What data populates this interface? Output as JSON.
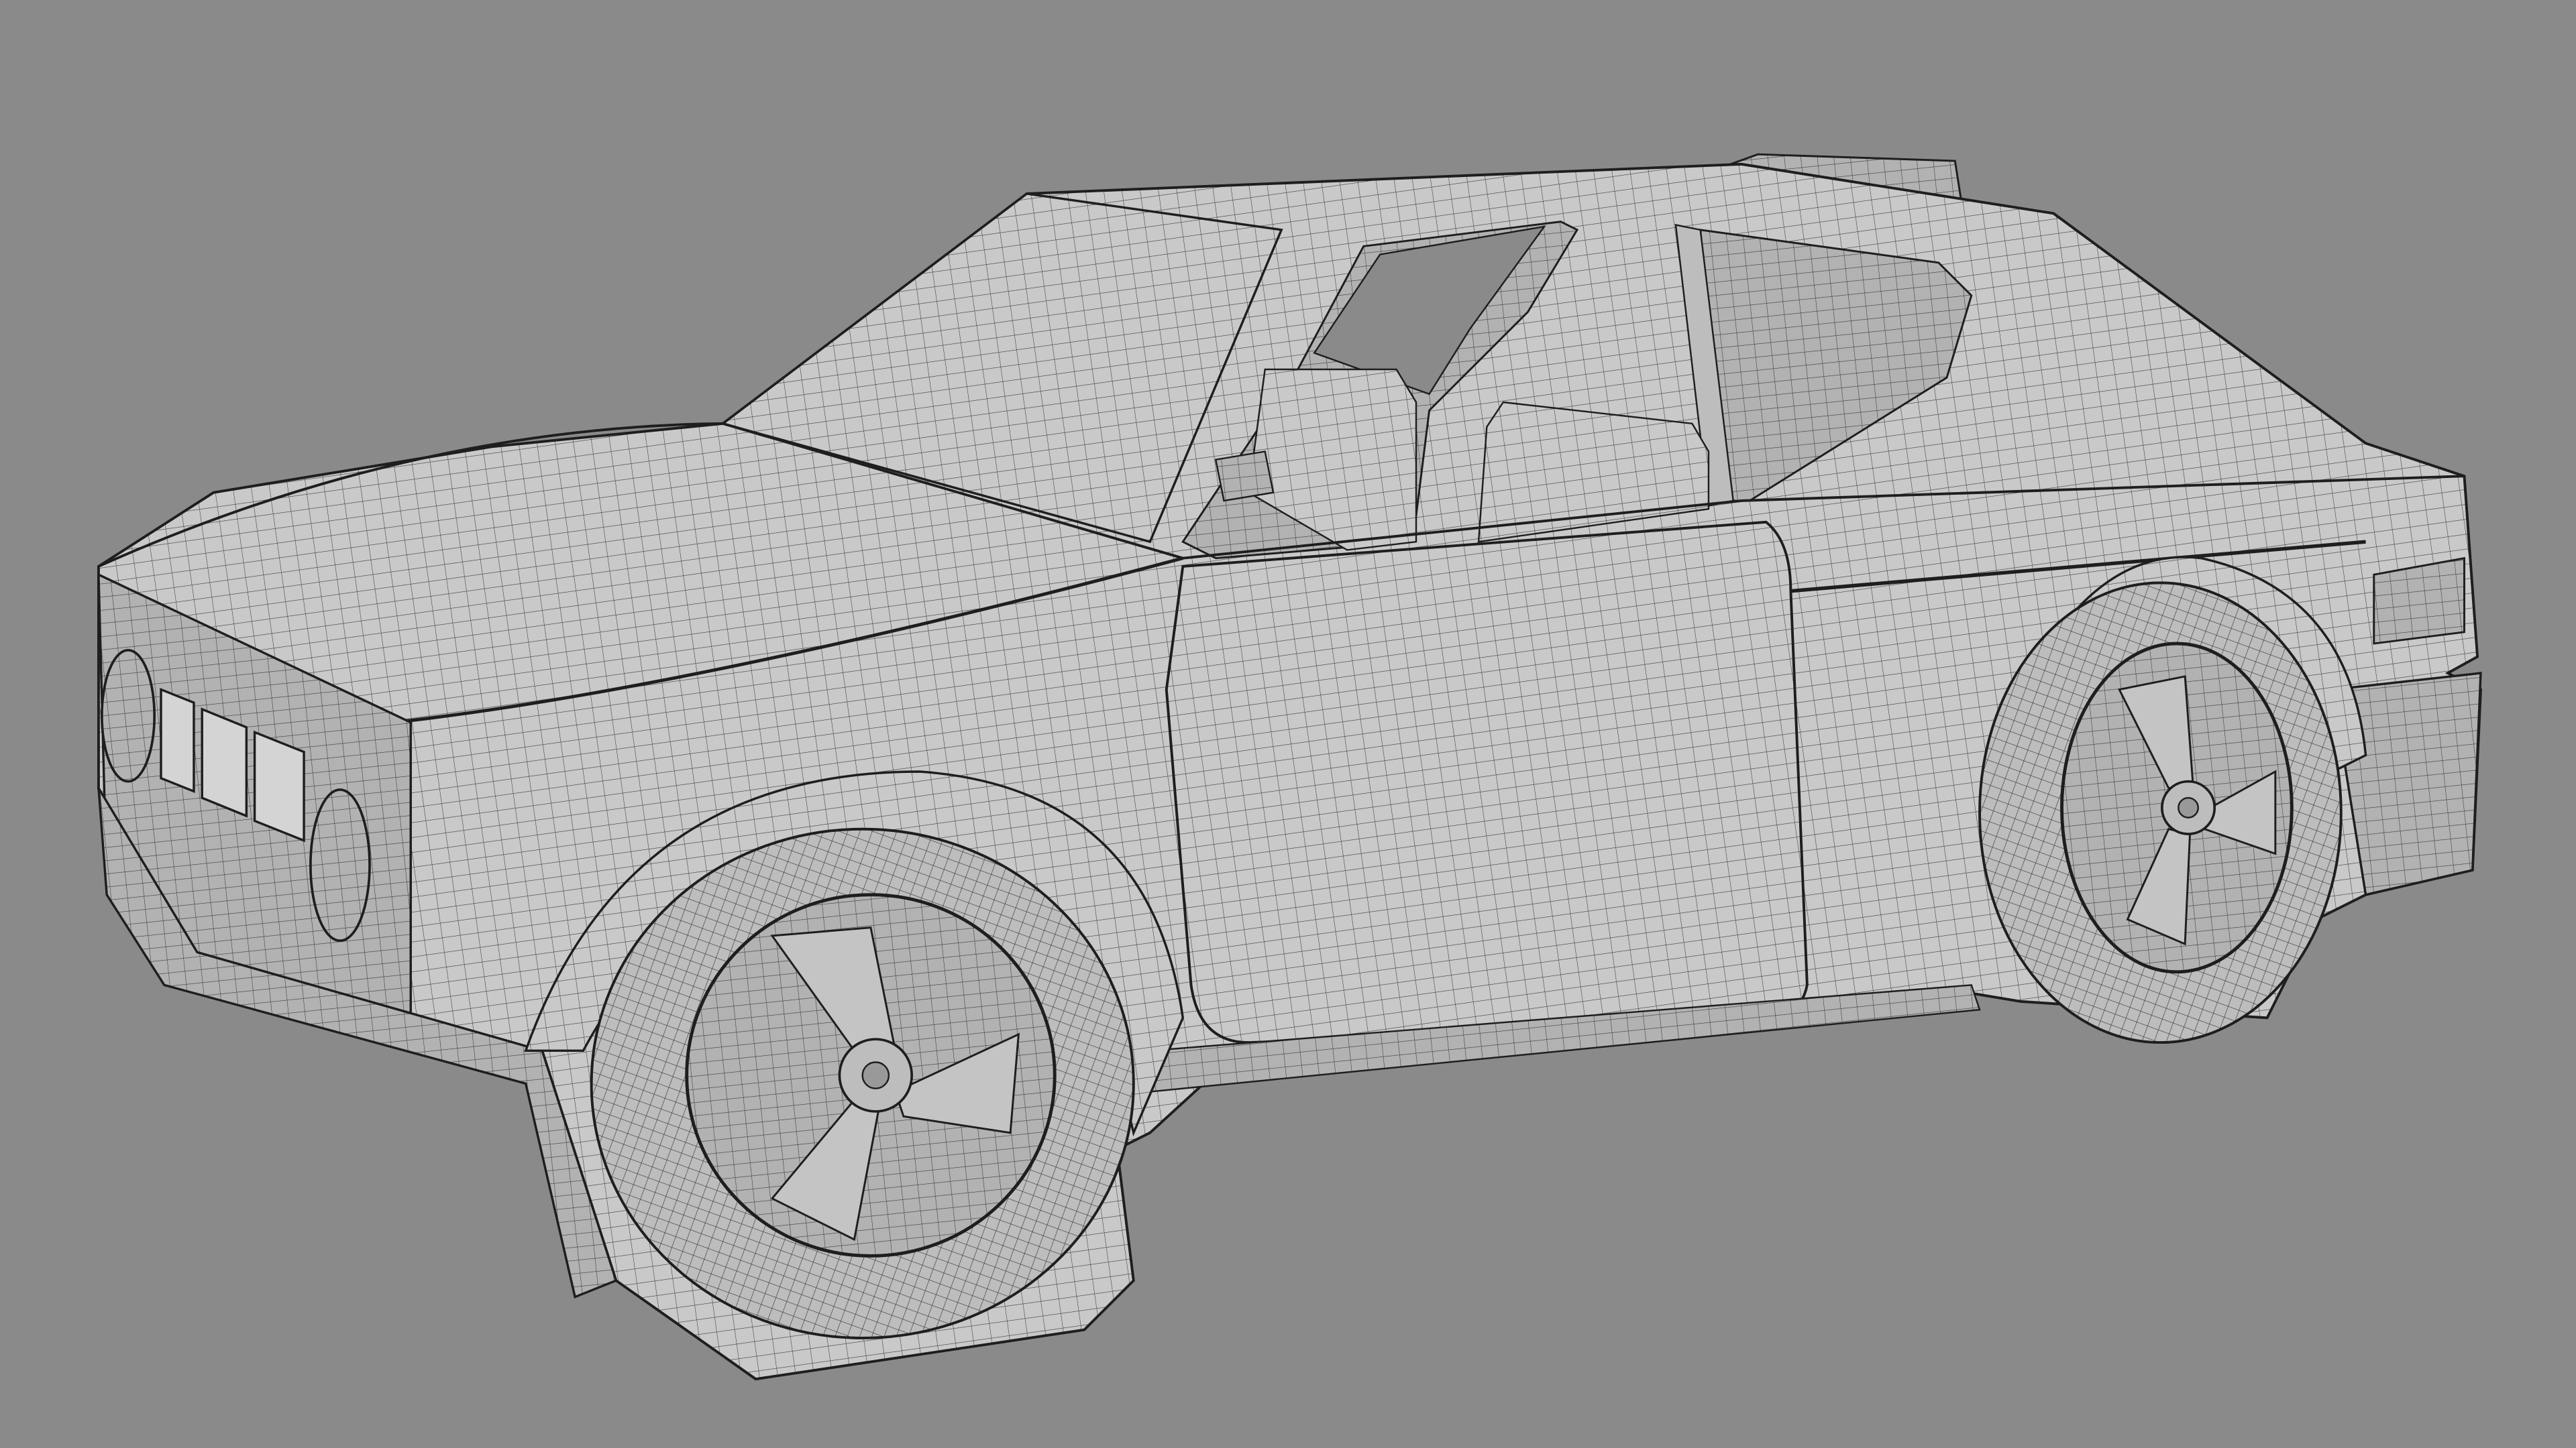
{
  "scene": {
    "background_color": "#8a8a8a",
    "model_color": "#c9c9c9",
    "shadow_color": "#a9a9a9",
    "wire_color": "#3c3c3c",
    "outline_color": "#1e1e1e"
  }
}
